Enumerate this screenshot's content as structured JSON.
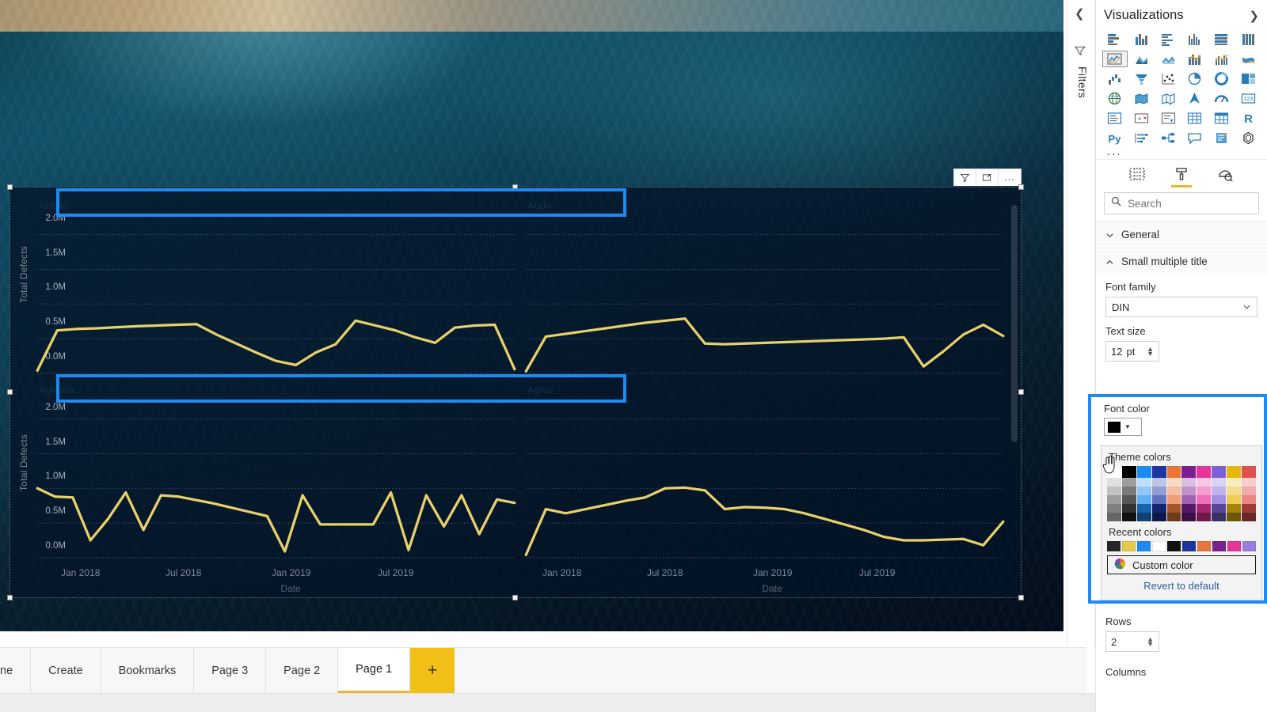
{
  "app": {
    "desktop_background": "#0c3c52"
  },
  "visual": {
    "toolbar": {
      "filter_icon": "filter-icon",
      "focus_icon": "focus-mode-icon",
      "more_label": "..."
    },
    "scrollbar": "vertical-scrollbar"
  },
  "chart_data": {
    "type": "line",
    "title": "",
    "xlabel": "Date",
    "ylabel": "Total Defects",
    "grid": true,
    "legend_position": "none",
    "series_color": "#e8d06a",
    "ylim": [
      0,
      2200000
    ],
    "ytick_labels": [
      "2.0M",
      "1.5M",
      "1.0M",
      "0.5M",
      "0.0M"
    ],
    "ytick_values": [
      2000000,
      1500000,
      1000000,
      500000,
      0
    ],
    "xtick_labels": [
      "Jan 2018",
      "Jul 2018",
      "Jan 2019",
      "Jul 2019"
    ],
    "small_multiples_rows": 2,
    "small_multiples_columns": 2,
    "panels": [
      {
        "title": "Abbas",
        "row": 1,
        "column": 1,
        "values": [
          40000,
          620000,
          640000,
          650000,
          665000,
          680000,
          690000,
          700000,
          710000,
          560000,
          430000,
          300000,
          180000,
          120000,
          300000,
          420000,
          760000,
          690000,
          620000,
          520000,
          440000,
          660000,
          690000,
          700000,
          60000
        ]
      },
      {
        "title": "Abdo",
        "row": 1,
        "column": 2,
        "values": [
          30000,
          530000,
          570000,
          610000,
          650000,
          690000,
          730000,
          760000,
          790000,
          430000,
          420000,
          430000,
          440000,
          450000,
          460000,
          470000,
          480000,
          490000,
          500000,
          520000,
          100000,
          320000,
          560000,
          700000,
          540000
        ]
      },
      {
        "title": "Agimba",
        "row": 2,
        "column": 1,
        "values": [
          1000000,
          880000,
          870000,
          250000,
          560000,
          940000,
          400000,
          900000,
          880000,
          830000,
          780000,
          720000,
          660000,
          600000,
          90000,
          900000,
          480000,
          480000,
          480000,
          480000,
          940000,
          110000,
          900000,
          450000,
          900000,
          340000,
          840000,
          790000
        ]
      },
      {
        "title": "Agivu",
        "row": 2,
        "column": 2,
        "values": [
          40000,
          700000,
          640000,
          700000,
          760000,
          820000,
          870000,
          1000000,
          1010000,
          970000,
          700000,
          730000,
          720000,
          700000,
          640000,
          560000,
          480000,
          400000,
          300000,
          250000,
          250000,
          260000,
          270000,
          180000,
          520000
        ]
      }
    ]
  },
  "page_tabs": {
    "items": [
      {
        "label": "ne",
        "active": false,
        "clipped": true
      },
      {
        "label": "Create",
        "active": false
      },
      {
        "label": "Bookmarks",
        "active": false
      },
      {
        "label": "Page 3",
        "active": false
      },
      {
        "label": "Page 2",
        "active": false
      },
      {
        "label": "Page 1",
        "active": true
      }
    ],
    "add_label": "+"
  },
  "filters_rail": {
    "collapse_icon": "chevron-left-icon",
    "flag_icon": "filter-flag-icon",
    "label": "Filters"
  },
  "visualizations_pane": {
    "title": "Visualizations",
    "expand_icon": "chevron-right-icon",
    "icons": [
      "stacked-bar-chart-icon",
      "stacked-column-chart-icon",
      "clustered-bar-chart-icon",
      "clustered-column-chart-icon",
      "100-stacked-bar-chart-icon",
      "100-stacked-column-chart-icon",
      "line-chart-icon",
      "area-chart-icon",
      "stacked-area-chart-icon",
      "line-stacked-column-chart-icon",
      "line-clustered-column-chart-icon",
      "ribbon-chart-icon",
      "waterfall-chart-icon",
      "funnel-icon",
      "scatter-chart-icon",
      "pie-chart-icon",
      "donut-chart-icon",
      "treemap-icon",
      "map-icon",
      "filled-map-icon",
      "shape-map-icon",
      "azure-map-icon",
      "gauge-icon",
      "card-icon",
      "multi-row-card-icon",
      "kpi-icon",
      "slicer-icon",
      "table-icon",
      "matrix-icon",
      "r-script-visual-icon",
      "python-visual-icon",
      "key-influencers-icon",
      "decomposition-tree-icon",
      "qna-icon",
      "smart-narrative-icon",
      "paginated-report-icon"
    ],
    "selected_icon": "line-chart-icon",
    "more_label": "...",
    "pane_tabs": [
      {
        "name": "fields-tab",
        "active": false
      },
      {
        "name": "format-tab",
        "active": true
      },
      {
        "name": "analytics-tab",
        "active": false
      }
    ],
    "search": {
      "placeholder": "Search",
      "value": "",
      "icon": "search-icon"
    },
    "sections": [
      {
        "label": "General",
        "expanded": false,
        "chevron": "chevron-down-icon"
      },
      {
        "label": "Small multiple title",
        "expanded": true,
        "chevron": "chevron-up-icon"
      }
    ],
    "properties": {
      "font_family": {
        "label": "Font family",
        "value": "DIN"
      },
      "text_size": {
        "label": "Text size",
        "value": "12",
        "unit": "pt"
      },
      "font_color": {
        "label": "Font color",
        "current": "#000000",
        "theme_label": "Theme colors",
        "recent_label": "Recent colors",
        "custom_label": "Custom color",
        "revert_label": "Revert to default",
        "theme_base": [
          "#ffffff",
          "#000000",
          "#1f8bf0",
          "#1c35a0",
          "#e8763c",
          "#7a1f8f",
          "#e8339a",
          "#7b61d6",
          "#e5b80e",
          "#e0504f"
        ],
        "recent": [
          "#262626",
          "#e8c84a",
          "#1f8bf0",
          "#ffffff",
          "#111111",
          "#1c35a0",
          "#e8763c",
          "#7a1f8f",
          "#e8339a",
          "#9b7fe0"
        ]
      },
      "rows": {
        "label": "Rows",
        "value": "2"
      },
      "columns": {
        "label": "Columns"
      }
    }
  }
}
